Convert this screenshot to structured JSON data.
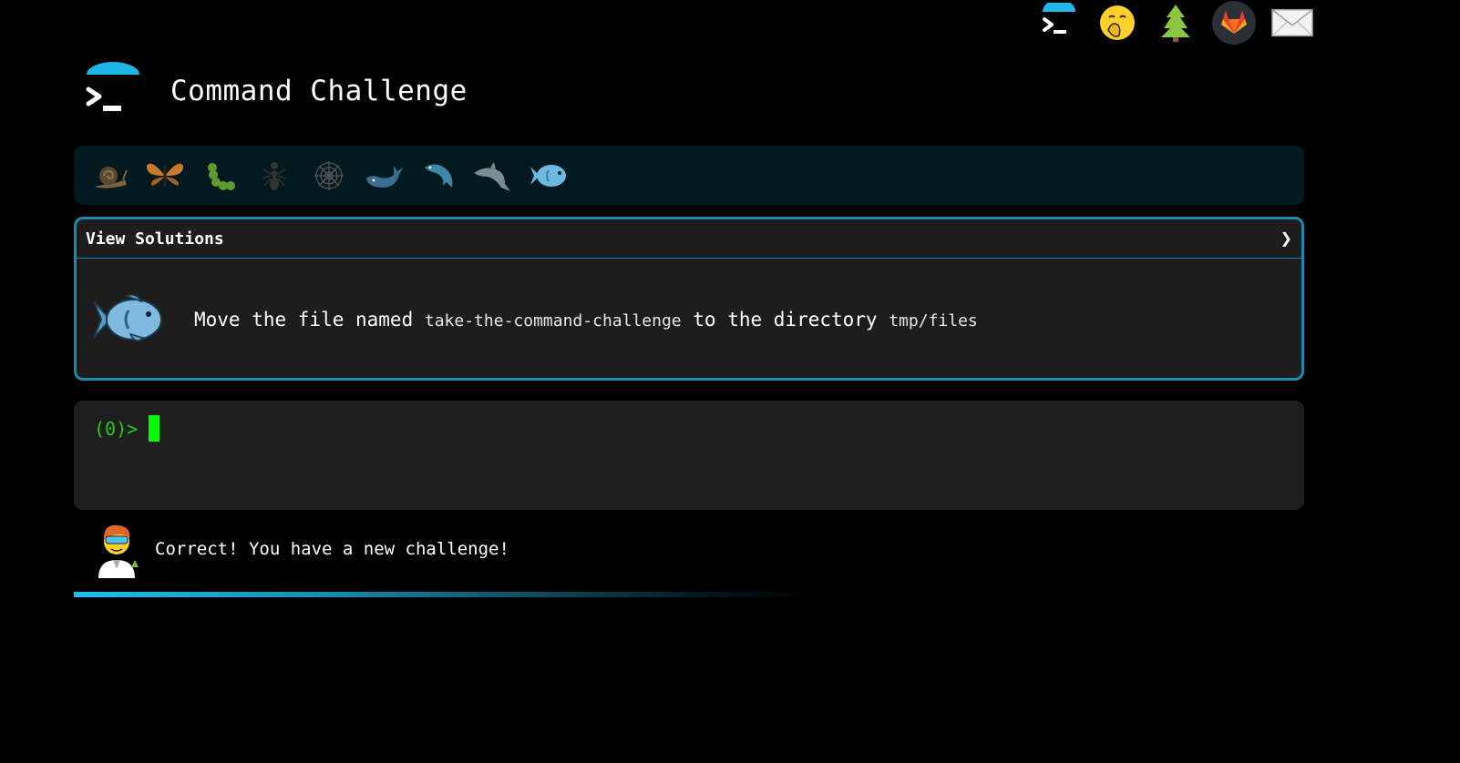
{
  "nav": {
    "icons": [
      "terminal-logo-icon",
      "hand-over-mouth-emoji-icon",
      "evergreen-tree-icon",
      "gitlab-icon",
      "envelope-icon"
    ]
  },
  "header": {
    "title": "Command Challenge"
  },
  "levels": [
    "snail",
    "butterfly",
    "caterpillar",
    "ant",
    "spider-web",
    "whale",
    "dolphin",
    "dolphin-jumping",
    "fish"
  ],
  "challenge": {
    "solutions_label": "View Solutions",
    "chevron": "❯",
    "text_before": "Move the file named ",
    "file": "take-the-command-challenge",
    "text_middle": " to the directory ",
    "directory": "tmp/files"
  },
  "terminal": {
    "prompt": "(0)>"
  },
  "feedback": {
    "message": "Correct! You have a new challenge!"
  },
  "colors": {
    "accent": "#1a8aad",
    "prompt": "#22cc22",
    "cursor": "#00ff00",
    "level_bar": "#031920"
  }
}
